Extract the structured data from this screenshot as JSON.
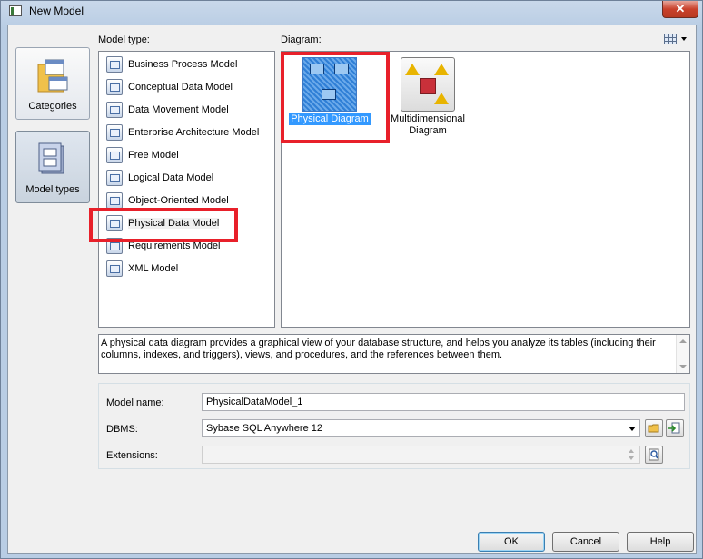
{
  "window": {
    "title": "New Model",
    "close_symbol": "✕"
  },
  "categories": [
    {
      "label": "Categories",
      "icon": "categories-folder-icon"
    },
    {
      "label": "Model types",
      "icon": "model-types-icon",
      "active": true
    }
  ],
  "model_type": {
    "label": "Model type:",
    "items": [
      {
        "label": "Business Process Model",
        "icon": "business-process-icon"
      },
      {
        "label": "Conceptual Data Model",
        "icon": "conceptual-data-icon"
      },
      {
        "label": "Data Movement Model",
        "icon": "data-movement-icon"
      },
      {
        "label": "Enterprise Architecture Model",
        "icon": "enterprise-architecture-icon"
      },
      {
        "label": "Free Model",
        "icon": "free-model-icon"
      },
      {
        "label": "Logical Data Model",
        "icon": "logical-data-icon"
      },
      {
        "label": "Object-Oriented Model",
        "icon": "object-oriented-icon"
      },
      {
        "label": "Physical Data Model",
        "icon": "physical-data-icon",
        "selected": true
      },
      {
        "label": "Requirements Model",
        "icon": "requirements-icon"
      },
      {
        "label": "XML Model",
        "icon": "xml-model-icon"
      }
    ]
  },
  "diagram": {
    "label": "Diagram:",
    "items": [
      {
        "label": "Physical Diagram",
        "icon": "physical-diagram-icon",
        "selected": true
      },
      {
        "label_line1": "Multidimensional",
        "label_line2": "Diagram",
        "icon": "multidimensional-diagram-icon"
      }
    ]
  },
  "description": "A physical data diagram provides a graphical view of your database structure, and helps you analyze its tables (including their columns, indexes, and triggers), views, and procedures, and the references between them.",
  "form": {
    "model_name_label": "Model name:",
    "model_name_value": "PhysicalDataModel_1",
    "dbms_label": "DBMS:",
    "dbms_value": "Sybase SQL Anywhere 12",
    "extensions_label": "Extensions:",
    "extensions_value": ""
  },
  "buttons": {
    "ok": "OK",
    "cancel": "Cancel",
    "help": "Help"
  },
  "colors": {
    "highlight_red": "#e8202a",
    "selection_blue": "#3399ff"
  }
}
